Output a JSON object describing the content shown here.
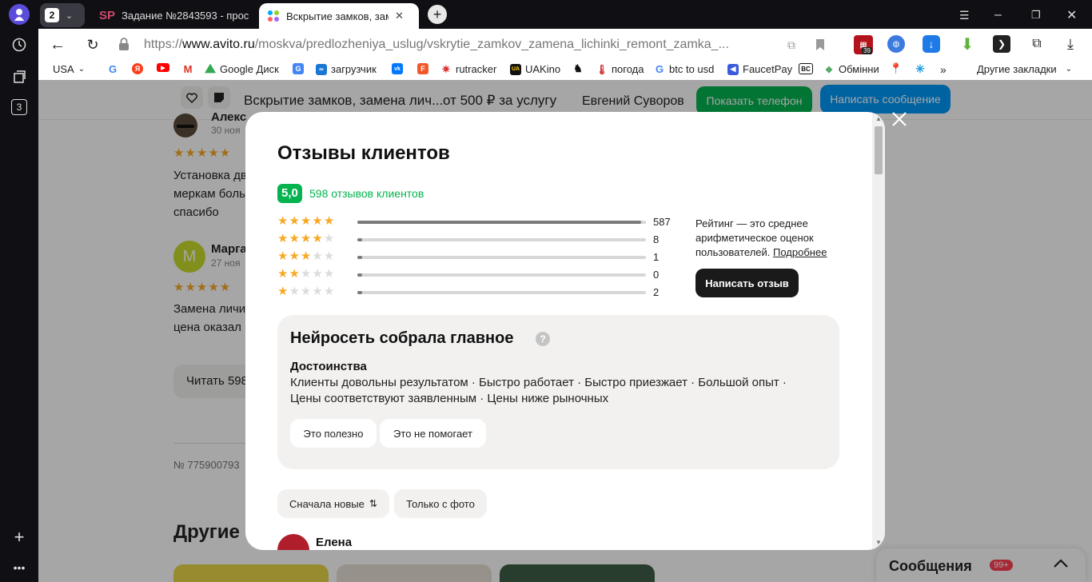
{
  "browser": {
    "tab_count": "2",
    "tabs": [
      {
        "label": "Задание №2843593 - прос"
      },
      {
        "label": "Вскрытие замков, заме"
      }
    ],
    "side_badge": "3",
    "url_scheme": "https://",
    "url_host": "www.avito.ru",
    "url_path": "/moskva/predlozheniya_uslug/vskrytie_zamkov_zamena_lichinki_remont_zamka_...",
    "ext_badge": "39",
    "bookmarks": [
      {
        "label": "USA",
        "icon": "chevron-down-icon"
      },
      {
        "label": "",
        "icon": "google-icon"
      },
      {
        "label": "",
        "icon": "yandex-icon"
      },
      {
        "label": "",
        "icon": "youtube-icon"
      },
      {
        "label": "",
        "icon": "gmail-icon"
      },
      {
        "label": "Google Диск",
        "icon": "drive-icon"
      },
      {
        "label": "",
        "icon": "translate-icon"
      },
      {
        "label": "загрузчик",
        "icon": "loader-icon"
      },
      {
        "label": "",
        "icon": "vk-icon"
      },
      {
        "label": "",
        "icon": "fb-icon"
      },
      {
        "label": "rutracker",
        "icon": "rutracker-icon"
      },
      {
        "label": "UAKino",
        "icon": "uakino-icon"
      },
      {
        "label": "",
        "icon": "chess-icon"
      },
      {
        "label": "погода",
        "icon": "thermometer-icon"
      },
      {
        "label": "btc to usd",
        "icon": "google-icon"
      },
      {
        "label": "FaucetPay",
        "icon": "faucetpay-icon"
      },
      {
        "label": "",
        "icon": "bc-icon"
      },
      {
        "label": "Обмінни",
        "icon": "exchange-icon"
      },
      {
        "label": "",
        "icon": "maps-icon"
      },
      {
        "label": "",
        "icon": "star-icon"
      }
    ],
    "other_bookmarks": "Другие закладки"
  },
  "sticky": {
    "title": "Вскрытие замков, замена лич...",
    "price": "от 500 ₽ за услугу",
    "seller": "Евгений Суворов",
    "show_phone": "Показать телефон",
    "write_message": "Написать сообщение"
  },
  "background": {
    "review1_name": "Алекс",
    "review1_date": "30 ноя",
    "review1_text1": "Установка дв",
    "review1_text2": "меркам боль",
    "review1_text3": "спасибо",
    "review2_initial": "М",
    "review2_name": "Марга",
    "review2_date": "27 ноя",
    "review2_text1": "Замена личи",
    "review2_text2": "цена оказал",
    "read_all": "Читать 598",
    "listing_no": "№ 775900793",
    "others_heading": "Другие",
    "messages": "Сообщения",
    "messages_badge": "99+"
  },
  "modal": {
    "title": "Отзывы клиентов",
    "rating": "5,0",
    "reviews_count": "598 отзывов клиентов",
    "rating_info": "Рейтинг — это среднее арифметическое оценок пользователей.",
    "more_link": "Подробнее",
    "write_review": "Написать отзыв",
    "ai_title": "Нейросеть собрала главное",
    "pros_heading": "Достоинства",
    "pros_line1": "Клиенты довольны результатом · Быстро работает · Быстро приезжает · Большой опыт ·",
    "pros_line2": "Цены соответствуют заявленным · Цены ниже рыночных",
    "useful_btn": "Это полезно",
    "not_useful_btn": "Это не помогает",
    "sort_btn": "Сначала новые",
    "photo_btn": "Только с фото",
    "first_reviewer": "Елена"
  },
  "chart_data": {
    "type": "bar",
    "categories": [
      "5",
      "4",
      "3",
      "2",
      "1"
    ],
    "values": [
      587,
      8,
      1,
      0,
      2
    ]
  },
  "colors": {
    "accent_green": "#04b34f",
    "blue_button": "#0099f7",
    "star": "#f7a925",
    "dark_button": "#1a1a1a"
  }
}
